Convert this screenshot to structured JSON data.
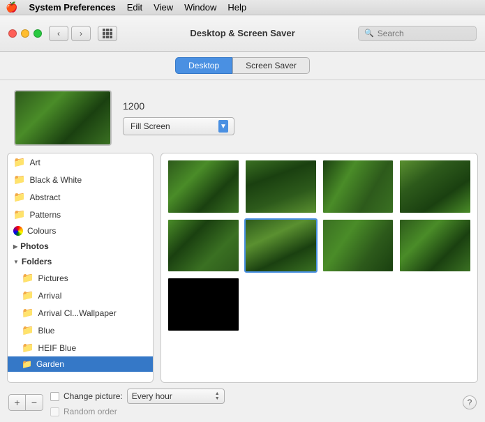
{
  "menubar": {
    "apple": "🍎",
    "app_name": "System Preferences",
    "menu_items": [
      "Edit",
      "View",
      "Window",
      "Help"
    ]
  },
  "titlebar": {
    "title": "Desktop & Screen Saver",
    "search_placeholder": "Search",
    "nav_back": "‹",
    "nav_forward": "›"
  },
  "tabs": {
    "desktop_label": "Desktop",
    "screen_saver_label": "Screen Saver",
    "active": "Desktop"
  },
  "preview": {
    "number": "1200",
    "fill_screen_label": "Fill Screen"
  },
  "sidebar": {
    "folders": [
      {
        "label": "Art",
        "icon": "folder"
      },
      {
        "label": "Black & White",
        "icon": "folder"
      },
      {
        "label": "Abstract",
        "icon": "folder"
      },
      {
        "label": "Patterns",
        "icon": "folder"
      },
      {
        "label": "Colours",
        "icon": "colorful"
      }
    ],
    "photos_label": "Photos",
    "folders_label": "Folders",
    "sub_folders": [
      {
        "label": "Pictures",
        "icon": "folder"
      },
      {
        "label": "Arrival",
        "icon": "folder"
      },
      {
        "label": "Arrival Cl...Wallpaper",
        "icon": "folder"
      },
      {
        "label": "Blue",
        "icon": "folder"
      },
      {
        "label": "HEIF Blue",
        "icon": "folder"
      },
      {
        "label": "Garden",
        "icon": "folder",
        "selected": true
      }
    ]
  },
  "bottom": {
    "add_btn": "+",
    "remove_btn": "−",
    "change_picture_label": "Change picture:",
    "interval_value": "Every hour",
    "random_order_label": "Random order",
    "help_label": "?"
  }
}
